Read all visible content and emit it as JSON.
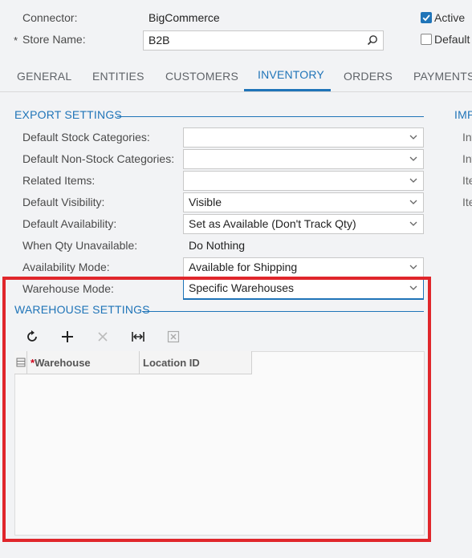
{
  "header": {
    "connector_label": "Connector:",
    "connector_value": "BigCommerce",
    "store_required_mark": "*",
    "store_label": "Store Name:",
    "store_value": "B2B",
    "active_label": "Active",
    "active_checked": true,
    "default_label": "Default",
    "default_checked": false
  },
  "tabs": [
    {
      "label": "GENERAL",
      "active": false
    },
    {
      "label": "ENTITIES",
      "active": false
    },
    {
      "label": "CUSTOMERS",
      "active": false
    },
    {
      "label": "INVENTORY",
      "active": true
    },
    {
      "label": "ORDERS",
      "active": false
    },
    {
      "label": "PAYMENTS",
      "active": false
    }
  ],
  "export_settings": {
    "title": "EXPORT SETTINGS",
    "fields": [
      {
        "label": "Default Stock Categories:",
        "value": ""
      },
      {
        "label": "Default Non-Stock Categories:",
        "value": ""
      },
      {
        "label": "Related Items:",
        "value": ""
      },
      {
        "label": "Default Visibility:",
        "value": "Visible"
      },
      {
        "label": "Default Availability:",
        "value": "Set as Available (Don't Track Qty)"
      },
      {
        "label": "When Qty Unavailable:",
        "value": "Do Nothing"
      },
      {
        "label": "Availability Mode:",
        "value": "Available for Shipping"
      },
      {
        "label": "Warehouse Mode:",
        "value": "Specific Warehouses"
      }
    ]
  },
  "import_settings": {
    "title_partial": "IMP",
    "labels_partial": [
      "Inv",
      "Inv",
      "Ite",
      "Ite"
    ]
  },
  "warehouse_settings": {
    "title": "WAREHOUSE SETTINGS",
    "columns": [
      {
        "required_mark": "*",
        "label": "Warehouse"
      },
      {
        "required_mark": "",
        "label": "Location ID"
      }
    ],
    "rows": []
  },
  "colors": {
    "accent": "#1f74b8",
    "highlight": "#e0262b"
  }
}
